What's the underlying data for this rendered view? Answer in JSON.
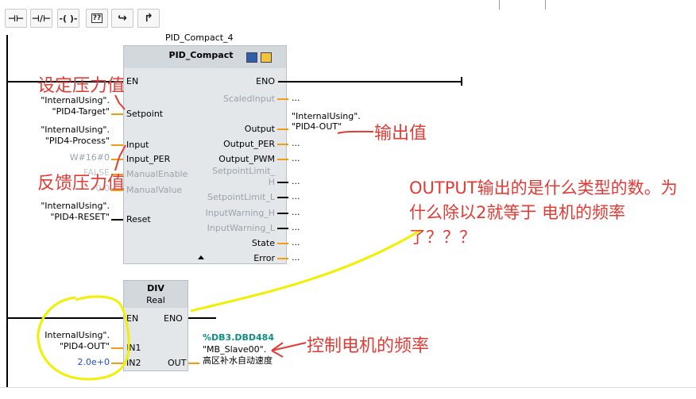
{
  "toolbar": {
    "buttons": [
      {
        "name": "no-contact",
        "glyph": "⊣⊢"
      },
      {
        "name": "nc-contact",
        "glyph": "⊣/⊢"
      },
      {
        "name": "coil",
        "glyph": "-( )-"
      },
      {
        "name": "empty-box",
        "glyph": "??"
      },
      {
        "name": "open-branch",
        "glyph": "↪"
      },
      {
        "name": "close-branch",
        "glyph": "↱"
      }
    ]
  },
  "network1": {
    "instance_label": "PID_Compact_4",
    "block_title": "PID_Compact",
    "inputs": {
      "en": "EN",
      "setpoint": "Setpoint",
      "input": "Input",
      "input_per": "Input_PER",
      "manual_enable": "ManualEnable",
      "manual_value": "ManualValue",
      "reset": "Reset"
    },
    "outputs": {
      "eno": "ENO",
      "scaled_input": "ScaledInput",
      "output": "Output",
      "output_per": "Output_PER",
      "output_pwm": "Output_PWM",
      "setpoint_limit_h1": "SetpointLimit_",
      "setpoint_limit_h2": "H",
      "setpoint_limit_l": "SetpointLimit_L",
      "input_warning_h": "InputWarning_H",
      "input_warning_l": "InputWarning_L",
      "state": "State",
      "error": "Error"
    },
    "operands": {
      "setpoint_a": "\"InternalUsing\".",
      "setpoint_b": "\"PID4-Target\"",
      "input_a": "\"InternalUsing\".",
      "input_b": "\"PID4-Process\"",
      "input_per": "W#16#0",
      "manual_enable": "FALSE",
      "manual_value": "0.0",
      "reset_a": "\"InternalUsing\".",
      "reset_b": "\"PID4-RESET\"",
      "output_a": "\"InternalUsing\".",
      "output_b": "\"PID4-OUT\"",
      "dots": "..."
    }
  },
  "network2": {
    "block_title": "DIV",
    "block_type": "Real",
    "pins": {
      "en": "EN",
      "eno": "ENO",
      "in1": "IN1",
      "in2": "IN2",
      "out": "OUT"
    },
    "operands": {
      "in1_a": "InternalUsing\".",
      "in1_b": "\"PID4-OUT\"",
      "in2": "2.0e+0",
      "out_addr": "%DB3.DBD484",
      "out_a": "\"MB_Slave00\".",
      "out_b": "高区补水自动速度"
    }
  },
  "annotations": {
    "setpoint": "设定压力值",
    "feedback": "反馈压力值",
    "output": "输出值",
    "question": "OUTPUT输出的是什么类型的数。为什么除以2就等于 电机的频率了？？？",
    "motor_freq": "控制电机的频率"
  },
  "colors": {
    "annotation": "#e23b35",
    "wire": "#000000",
    "pin": "#f39c12",
    "highlight": "#f0f000",
    "block": "#e3e7ea",
    "header": "#d2d8dc"
  }
}
